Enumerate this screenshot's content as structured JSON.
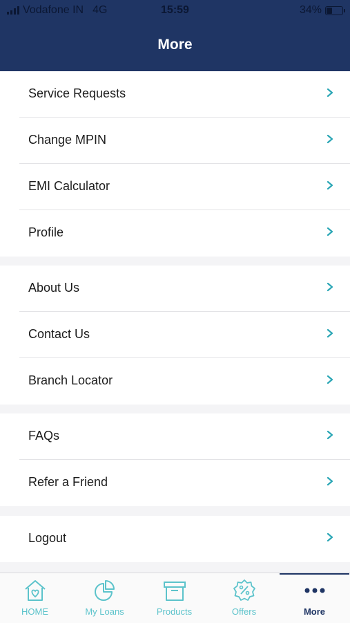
{
  "status": {
    "carrier": "Vodafone IN",
    "network": "4G",
    "time": "15:59",
    "battery": "34%"
  },
  "header": {
    "title": "More"
  },
  "groups": [
    {
      "items": [
        {
          "label": "Service Requests"
        },
        {
          "label": "Change MPIN"
        },
        {
          "label": "EMI Calculator"
        },
        {
          "label": "Profile"
        }
      ]
    },
    {
      "items": [
        {
          "label": "About Us"
        },
        {
          "label": "Contact Us"
        },
        {
          "label": "Branch Locator"
        }
      ]
    },
    {
      "items": [
        {
          "label": "FAQs"
        },
        {
          "label": "Refer a Friend"
        }
      ]
    },
    {
      "items": [
        {
          "label": "Logout"
        }
      ]
    }
  ],
  "tabs": [
    {
      "label": "HOME",
      "icon": "home-icon"
    },
    {
      "label": "My Loans",
      "icon": "pie-chart-icon"
    },
    {
      "label": "Products",
      "icon": "box-icon"
    },
    {
      "label": "Offers",
      "icon": "offer-badge-icon"
    },
    {
      "label": "More",
      "icon": "more-dots-icon"
    }
  ],
  "colors": {
    "header": "#1f3564",
    "accent": "#5cc3cb",
    "chevron": "#2aa6b5"
  }
}
